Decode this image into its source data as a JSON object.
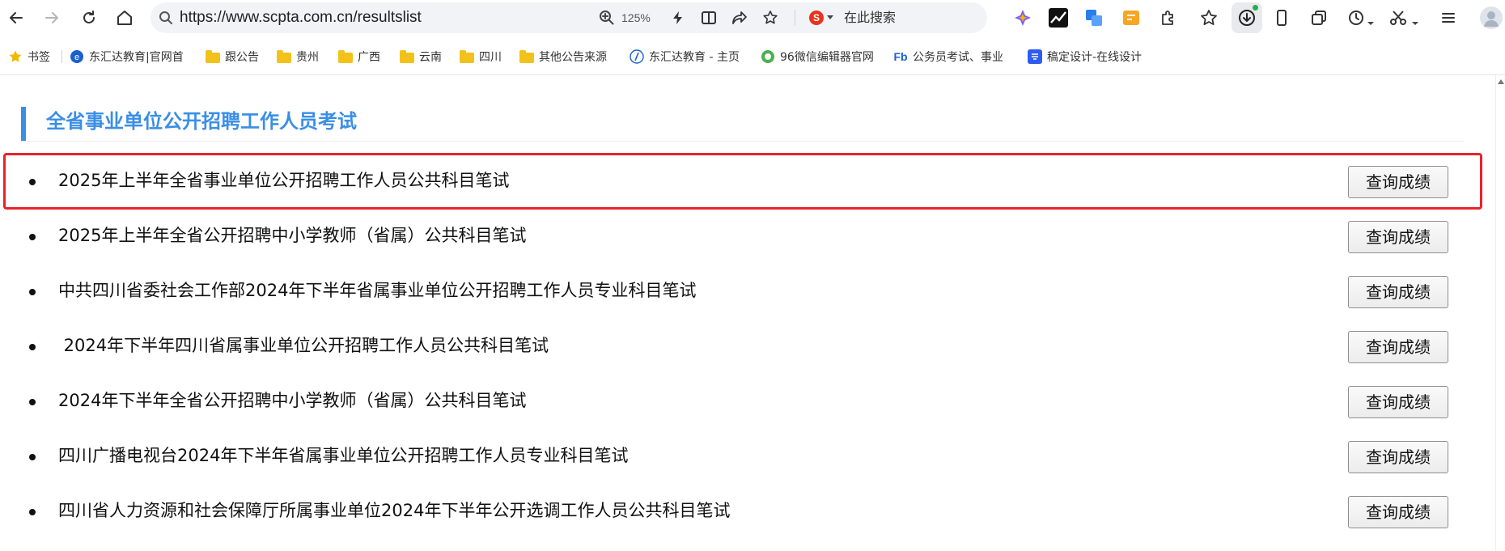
{
  "browser": {
    "url": "https://www.scpta.com.cn/resultslist",
    "zoom": "125%",
    "search_label": "在此搜索",
    "search_engine_badge": "S"
  },
  "bookmarks": [
    {
      "label": "书签",
      "icon": "star-icon"
    },
    {
      "label": "东汇达教育|官网首",
      "icon": "site-icon"
    },
    {
      "label": "跟公告",
      "icon": "folder-icon"
    },
    {
      "label": "贵州",
      "icon": "folder-icon"
    },
    {
      "label": "广西",
      "icon": "folder-icon"
    },
    {
      "label": "云南",
      "icon": "folder-icon"
    },
    {
      "label": "四川",
      "icon": "folder-icon"
    },
    {
      "label": "其他公告来源",
      "icon": "folder-icon"
    },
    {
      "label": "东汇达教育 - 主页",
      "icon": "site-icon"
    },
    {
      "label": "96微信编辑器官网",
      "icon": "site-icon"
    },
    {
      "label": "公务员考试、事业",
      "icon": "site-icon"
    },
    {
      "label": "稿定设计-在线设计",
      "icon": "site-icon"
    }
  ],
  "page": {
    "section_title": "全省事业单位公开招聘工作人员考试",
    "button_label": "查询成绩",
    "items": [
      {
        "title": "2025年上半年全省事业单位公开招聘工作人员公共科目笔试",
        "highlighted": true
      },
      {
        "title": "2025年上半年全省公开招聘中小学教师（省属）公共科目笔试",
        "highlighted": false
      },
      {
        "title": "中共四川省委社会工作部2024年下半年省属事业单位公开招聘工作人员专业科目笔试",
        "highlighted": false
      },
      {
        "title": " 2024年下半年四川省属事业单位公开招聘工作人员公共科目笔试",
        "highlighted": false
      },
      {
        "title": "2024年下半年全省公开招聘中小学教师（省属）公共科目笔试",
        "highlighted": false
      },
      {
        "title": "四川广播电视台2024年下半年省属事业单位公开招聘工作人员专业科目笔试",
        "highlighted": false
      },
      {
        "title": "四川省人力资源和社会保障厅所属事业单位2024年下半年公开选调工作人员公共科目笔试",
        "highlighted": false
      }
    ]
  },
  "colors": {
    "accent": "#3a8ee6",
    "highlight": "#e8232a"
  }
}
